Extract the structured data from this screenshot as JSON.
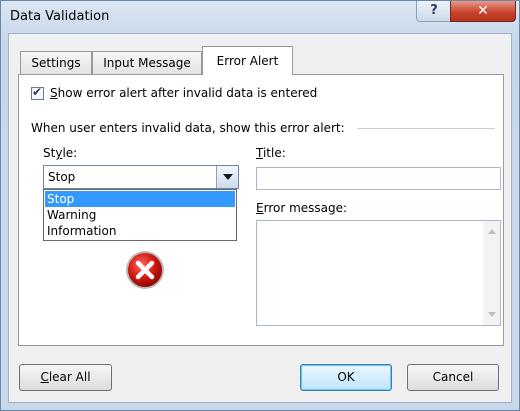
{
  "window": {
    "title": "Data Validation",
    "help": "?",
    "close": "✕"
  },
  "tabs": [
    {
      "label": "Settings"
    },
    {
      "label": "Input Message"
    },
    {
      "label": "Error Alert"
    }
  ],
  "error_alert": {
    "show_checkbox": {
      "checked": true,
      "label_first": "S",
      "label_rest": "how error alert after invalid data is entered"
    },
    "section_label": "When user enters invalid data, show this error alert:",
    "style_label_first": "St",
    "style_label_u": "y",
    "style_label_rest": "le:",
    "style_value": "Stop",
    "style_options": [
      "Stop",
      "Warning",
      "Information"
    ],
    "title_label_u": "T",
    "title_label_rest": "itle:",
    "title_value": "",
    "message_label_u": "E",
    "message_label_rest": "rror message:",
    "message_value": "",
    "icon": "error-stop-icon"
  },
  "buttons": {
    "clear_all_u": "C",
    "clear_all_rest": "lear All",
    "ok": "OK",
    "cancel": "Cancel"
  }
}
